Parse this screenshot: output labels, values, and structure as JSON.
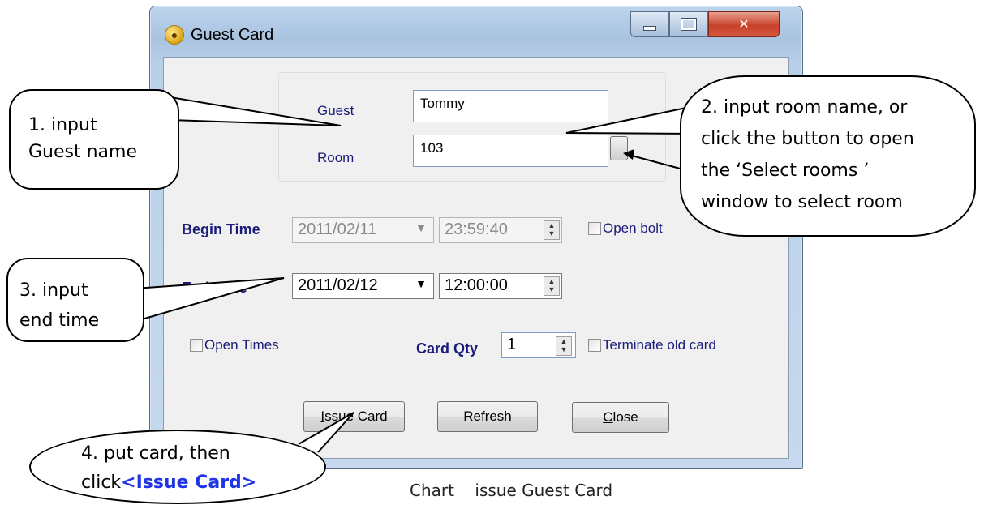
{
  "window": {
    "title": "Guest Card",
    "controls": {
      "minimize": "minimize",
      "maximize": "maximize",
      "close": "close"
    }
  },
  "form": {
    "guest_label": "Guest",
    "guest_value": "Tommy",
    "room_label": "Room",
    "room_value": "103",
    "begin_label": "Begin Time",
    "begin_date": "2011/02/11",
    "begin_time": "23:59:40",
    "open_bolt_label": "Open bolt",
    "end_label": "End Time",
    "end_date": "2011/02/12",
    "end_time": "12:00:00",
    "open_times_label": "Open Times",
    "card_qty_label": "Card Qty",
    "card_qty_value": "1",
    "terminate_label": "Terminate old card"
  },
  "buttons": {
    "issue": {
      "pre": "",
      "accel": "I",
      "post": "ssue Card"
    },
    "refresh": "Refresh",
    "close": {
      "pre": "",
      "accel": "C",
      "post": "lose"
    }
  },
  "callouts": {
    "one_line1": "1. input",
    "one_line2": "Guest name",
    "two_line1": "2. input room name, or",
    "two_line2": "click the button to open",
    "two_line3": "the ‘Select rooms ’",
    "two_line4": "window to select room",
    "three_line1": "3. input",
    "three_line2": "end time",
    "four_line1": "4. put card, then",
    "four_pre": "click",
    "four_hl": "<Issue Card>"
  },
  "caption": "Chart    issue Guest Card",
  "colors": {
    "label_text": "#1b1b7a",
    "callout_highlight": "#1f35e6",
    "close_button": "#c8412a"
  }
}
